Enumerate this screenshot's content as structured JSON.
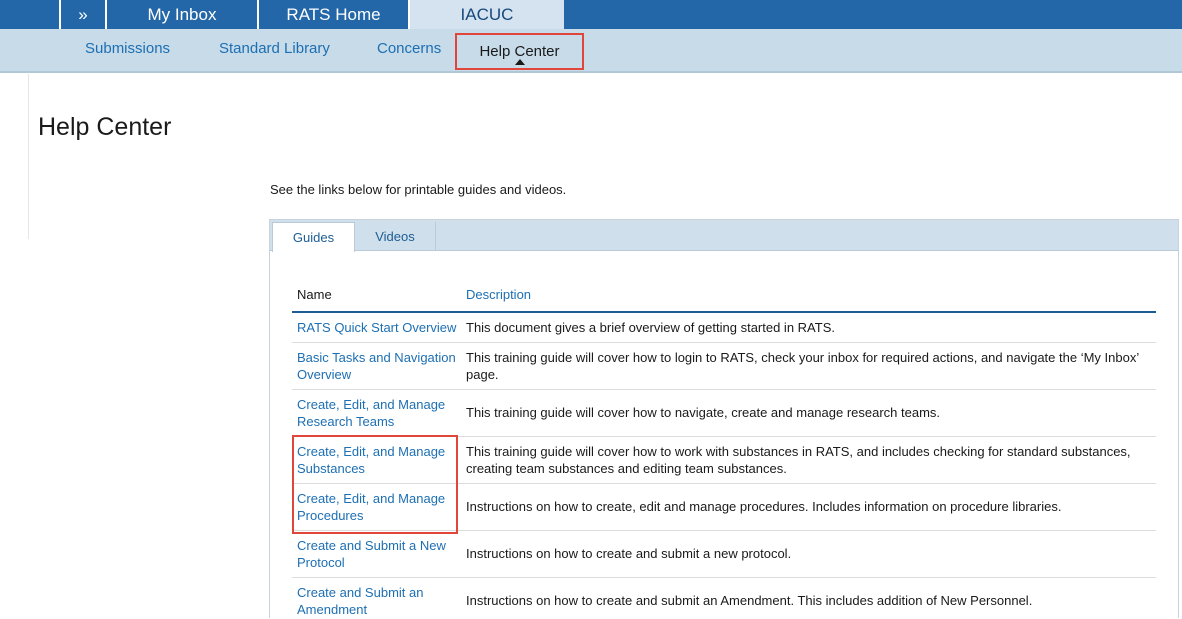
{
  "topnav": {
    "expand_label": "»",
    "tabs": [
      {
        "label": "My Inbox"
      },
      {
        "label": "RATS Home"
      },
      {
        "label": "IACUC"
      }
    ]
  },
  "subnav": {
    "items": [
      {
        "label": "Submissions"
      },
      {
        "label": "Standard Library"
      },
      {
        "label": "Concerns"
      },
      {
        "label": "Help Center"
      }
    ]
  },
  "page": {
    "title": "Help Center",
    "intro": "See the links below for printable guides and videos."
  },
  "panel": {
    "tabs": [
      {
        "label": "Guides"
      },
      {
        "label": "Videos"
      }
    ],
    "table": {
      "headers": {
        "name": "Name",
        "description": "Description"
      },
      "rows": [
        {
          "name": "RATS Quick Start Overview",
          "description": "This document gives a brief overview of getting started in RATS."
        },
        {
          "name": "Basic Tasks and Navigation Overview",
          "description": "This training guide will cover how to login to RATS, check your inbox for required actions, and navigate the ‘My Inbox’ page."
        },
        {
          "name": "Create, Edit, and Manage Research Teams",
          "description": "This training guide will cover how to navigate, create and manage research teams."
        },
        {
          "name": "Create, Edit, and Manage Substances",
          "description": "This training guide will cover how to work with substances in RATS, and includes checking for standard substances, creating team substances and editing team substances."
        },
        {
          "name": "Create, Edit, and Manage Procedures",
          "description": "Instructions on how to create, edit and manage procedures. Includes information on procedure libraries."
        },
        {
          "name": "Create and Submit a New Protocol",
          "description": "Instructions on how to create and submit a new protocol."
        },
        {
          "name": "Create and Submit an Amendment",
          "description": "Instructions on how to create and submit an Amendment. This includes addition of New Personnel."
        }
      ]
    }
  }
}
